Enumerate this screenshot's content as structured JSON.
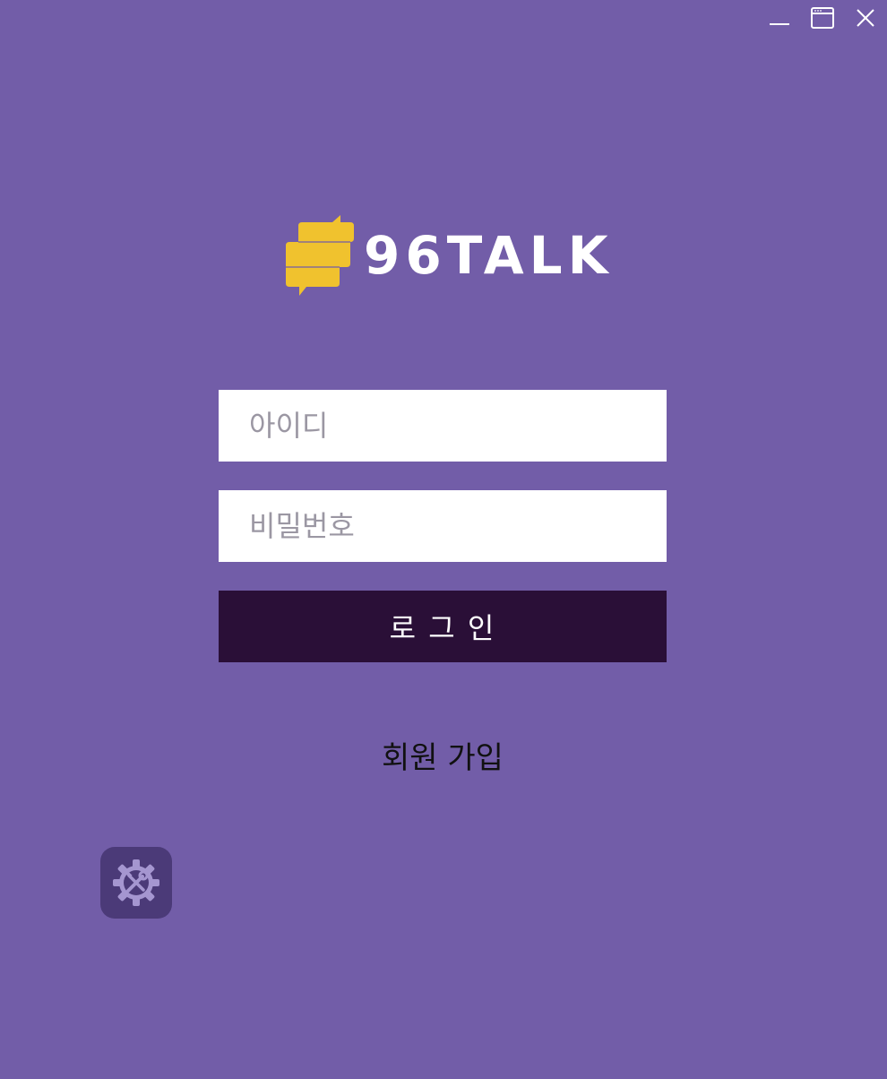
{
  "window": {
    "minimize_icon": "minimize-icon",
    "maximize_icon": "maximize-icon",
    "close_icon": "close-icon"
  },
  "logo": {
    "text": "96TALK",
    "icon": "chat-bubble-logo-icon",
    "icon_color": "#f0c22e"
  },
  "form": {
    "id_placeholder": "아이디",
    "password_placeholder": "비밀번호",
    "login_label": "로 그 인",
    "signup_label": "회원 가입"
  },
  "settings": {
    "icon": "gear-tools-icon"
  },
  "colors": {
    "background": "#725da8",
    "login_button": "#2a0f37",
    "settings_button": "#4b3a78",
    "placeholder": "#9b97a3"
  }
}
